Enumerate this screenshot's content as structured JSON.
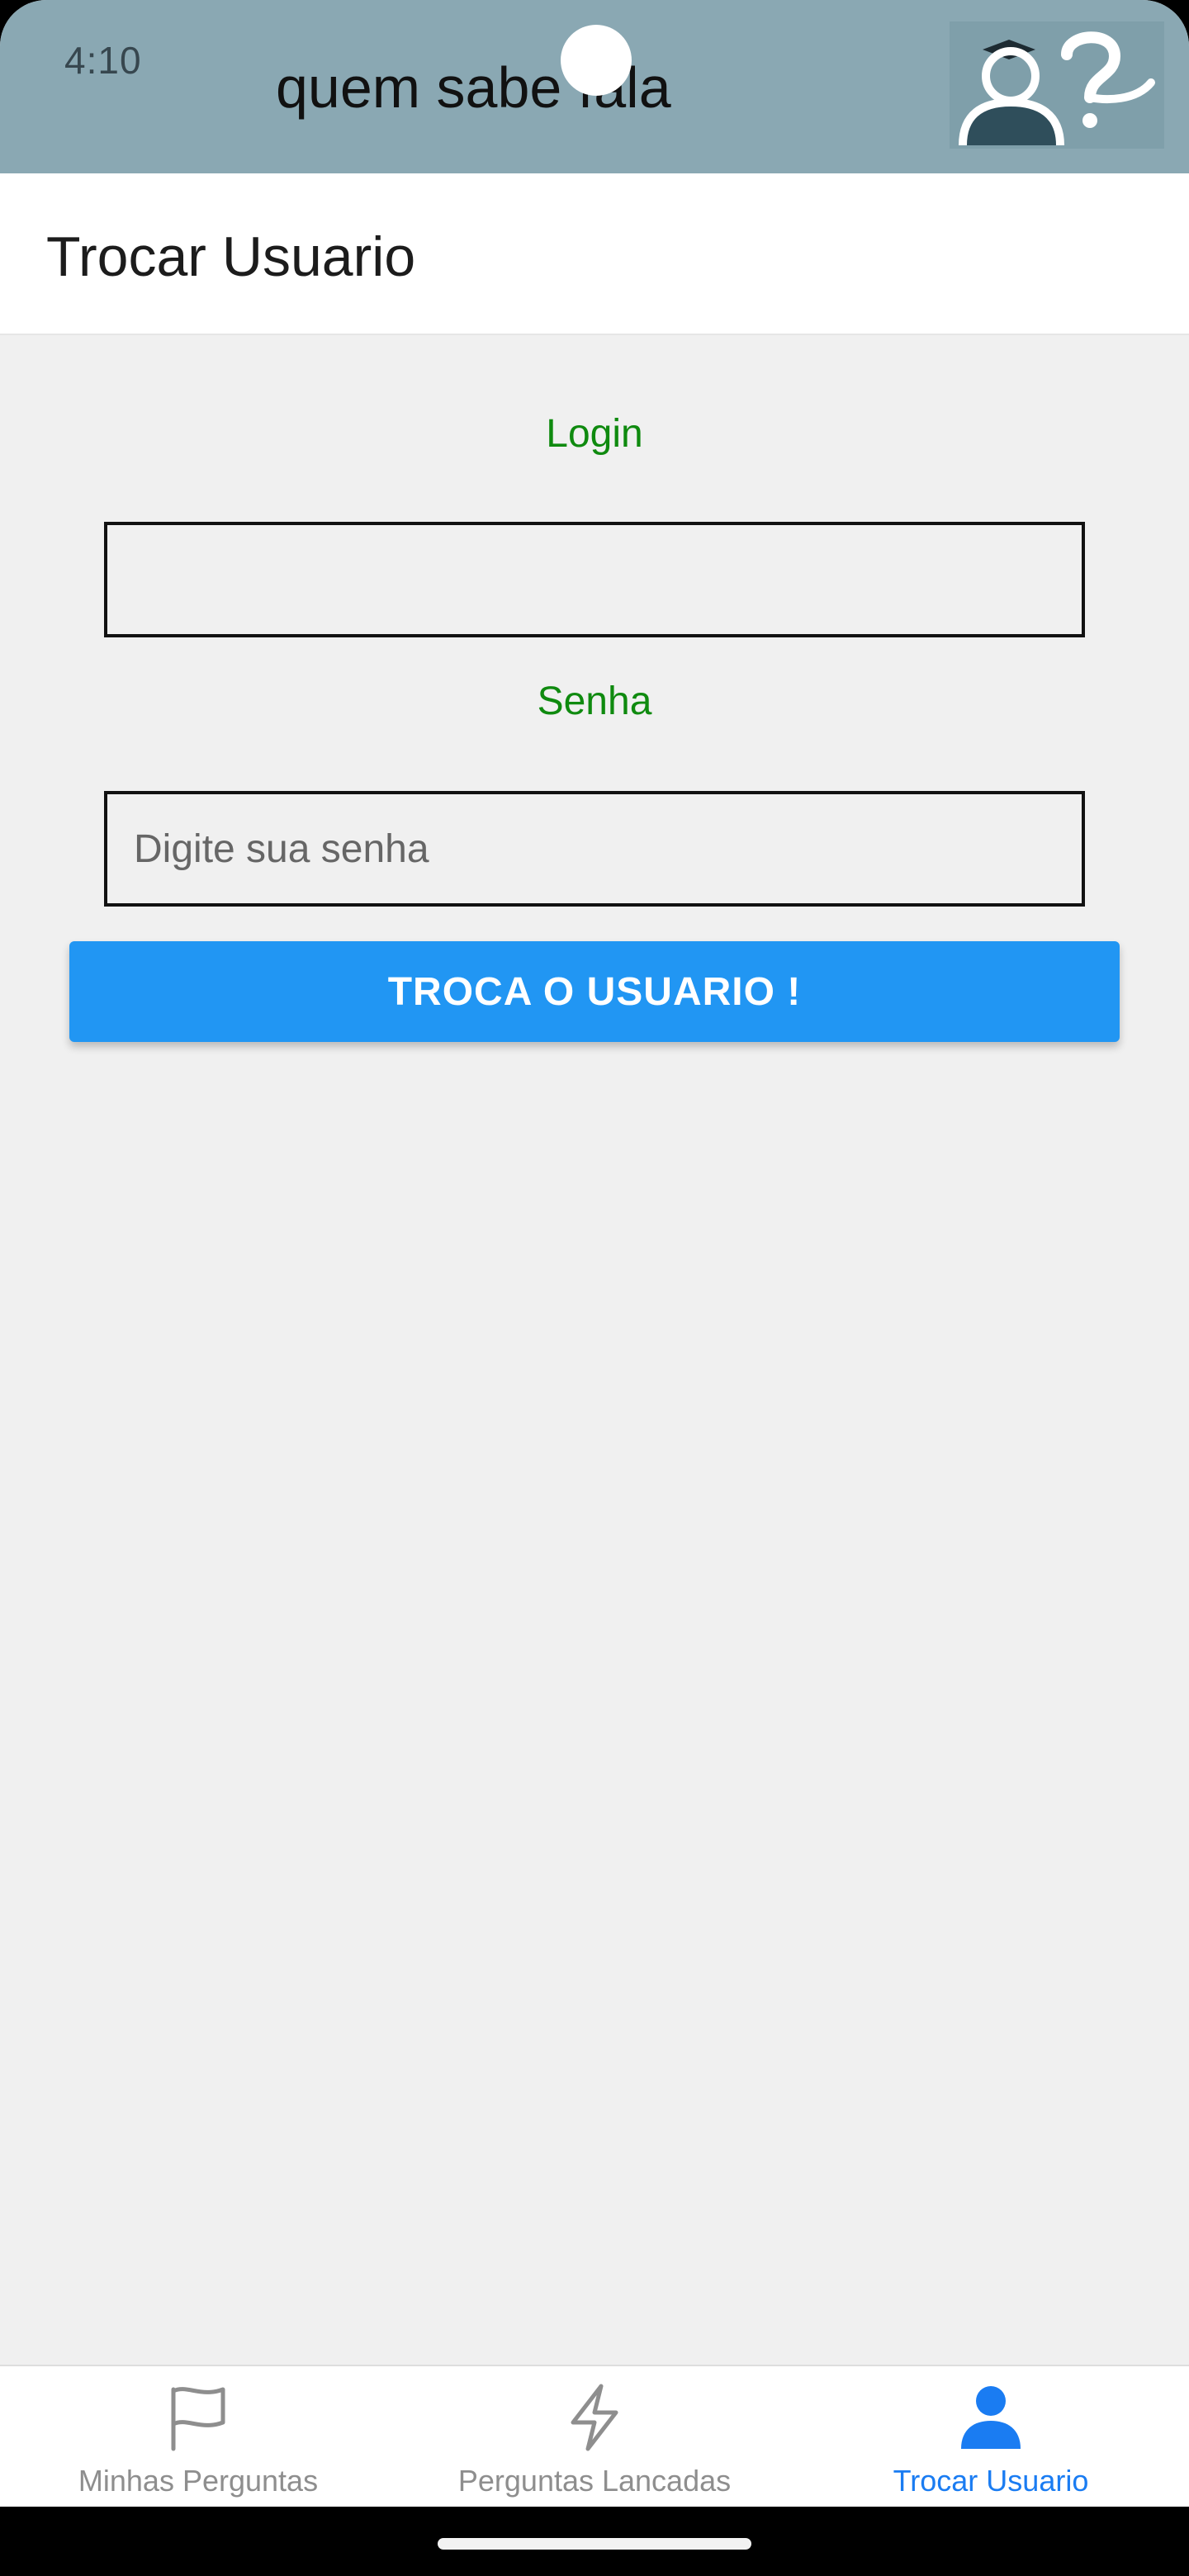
{
  "status_bar": {
    "time": "4:10"
  },
  "banner": {
    "title": "quem sabe fala",
    "logo_icon": "person-question-icon"
  },
  "header": {
    "title": "Trocar Usuario"
  },
  "form": {
    "login_label": "Login",
    "login_value": "",
    "login_placeholder": "",
    "senha_label": "Senha",
    "senha_value": "",
    "senha_placeholder": "Digite sua senha",
    "submit_label": "TROCA O USUARIO !"
  },
  "tab_bar": {
    "tabs": [
      {
        "label": "Minhas Perguntas",
        "icon": "flag-icon",
        "active": false
      },
      {
        "label": "Perguntas Lancadas",
        "icon": "lightning-icon",
        "active": false
      },
      {
        "label": "Trocar Usuario",
        "icon": "person-icon",
        "active": true
      }
    ]
  },
  "colors": {
    "banner": "#8aa8b3",
    "label_green": "#0f8a0f",
    "button_blue": "#2196f3",
    "active_tab": "#1a7cf2",
    "inactive_tab": "#8e8e8e",
    "background": "#f0f0f0"
  }
}
